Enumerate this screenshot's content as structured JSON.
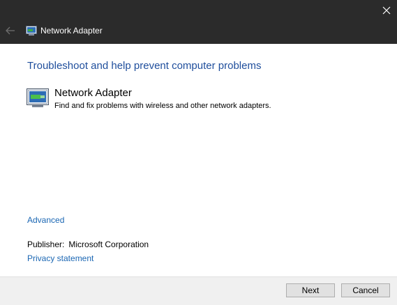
{
  "window": {
    "title": "Network Adapter",
    "close_glyph": "✕",
    "back_glyph": "←"
  },
  "main": {
    "heading": "Troubleshoot and help prevent computer problems",
    "item": {
      "name": "Network Adapter",
      "description": "Find and fix problems with wireless and other network adapters.",
      "icon": "network-adapter-icon"
    },
    "advanced_link": "Advanced",
    "publisher_label": "Publisher:",
    "publisher_value": "Microsoft Corporation",
    "privacy_link": "Privacy statement"
  },
  "footer": {
    "next_label": "Next",
    "cancel_label": "Cancel"
  },
  "colors": {
    "titlebar": "#2b2b2b",
    "heading": "#1f4e9c",
    "link": "#1a66b3"
  }
}
